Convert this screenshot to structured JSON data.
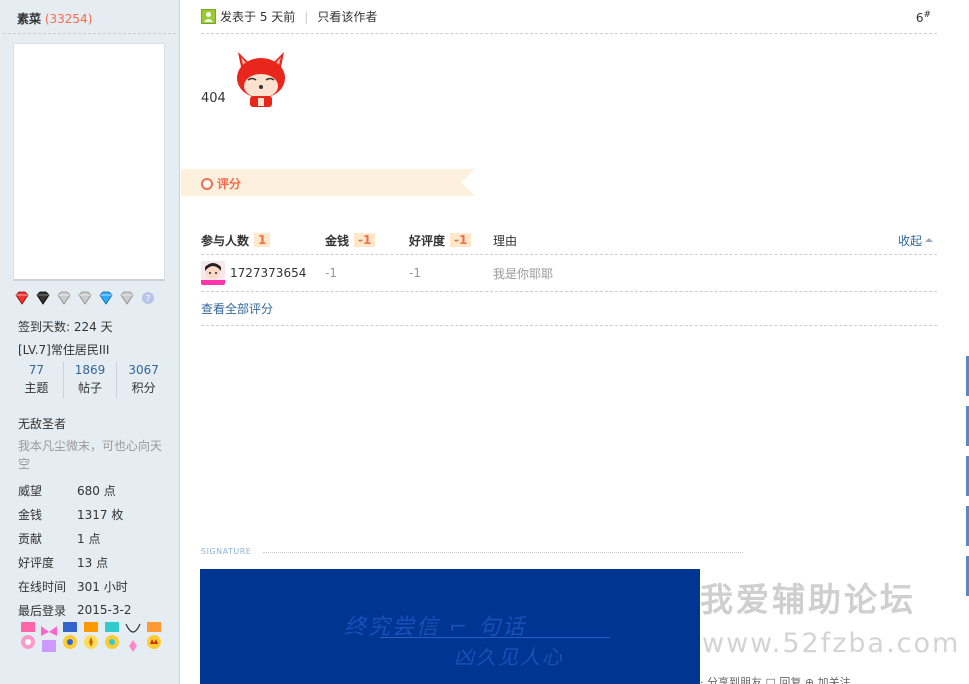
{
  "user": {
    "name": "素菜",
    "uid": "33254",
    "checkin": "签到天数: 224 天",
    "level": "[LV.7]常住居民III",
    "stats": [
      {
        "value": "77",
        "label": "主题"
      },
      {
        "value": "1869",
        "label": "帖子"
      },
      {
        "value": "3067",
        "label": "积分"
      }
    ],
    "custom_title": "无敌圣者",
    "signature_text": "我本凡尘微末，可也心向天空",
    "info": [
      {
        "key": "威望",
        "value": "680 点"
      },
      {
        "key": "金钱",
        "value": "1317 枚"
      },
      {
        "key": "贡献",
        "value": "1 点"
      },
      {
        "key": "好评度",
        "value": "13 点"
      },
      {
        "key": "在线时间",
        "value": "301 小时"
      },
      {
        "key": "最后登录",
        "value": "2015-3-2"
      }
    ],
    "gems": [
      "gem-red",
      "gem-dark",
      "gem-gray",
      "gem-gray",
      "gem-blue",
      "gem-gray",
      "gem-qmark"
    ]
  },
  "post": {
    "time": "发表于 5 天前",
    "only_author": "只看该作者",
    "floor": "6",
    "floor_suffix": "#",
    "body_text": "404"
  },
  "rating": {
    "title": "评分",
    "headers": {
      "participants": "参与人数",
      "participants_count": "1",
      "money": "金钱",
      "money_value": "-1",
      "reputation": "好评度",
      "reputation_value": "-1",
      "reason": "理由",
      "collapse": "收起"
    },
    "rows": [
      {
        "user": "1727373654",
        "money": "-1",
        "reputation": "-1",
        "reason": "我是你耶耶"
      }
    ],
    "view_all": "查看全部评分"
  },
  "signature": {
    "label": "SIGNATURE",
    "line1": "终究尝信 ⌐ 句话",
    "line2": "凶久见人心"
  },
  "watermark": {
    "cn": "我爱辅助论坛",
    "url": "www.52fzba.com"
  },
  "bottom_strip": "· 分享到朋友   □ 回复   ⊕ 加关注",
  "colors": {
    "sidebar_bg": "#e5edf2",
    "link": "#336699",
    "accent": "#f26c4f",
    "signature_bg": "#003591"
  }
}
